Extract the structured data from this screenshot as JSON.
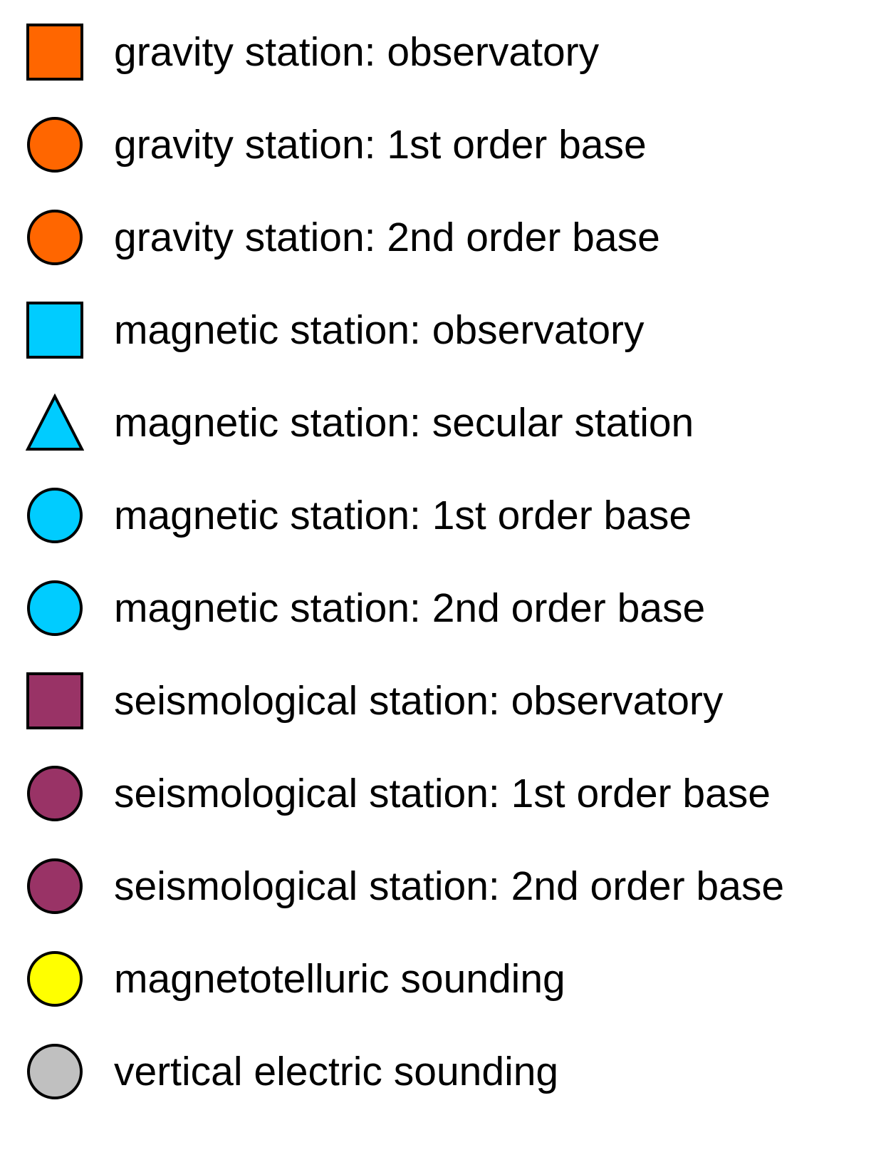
{
  "legend": {
    "items": [
      {
        "label": "gravity station: observatory",
        "shape": "square",
        "color": "#FF6600",
        "icon": "orange-square-icon"
      },
      {
        "label": "gravity station: 1st order base",
        "shape": "circle",
        "color": "#FF6600",
        "icon": "orange-circle-icon"
      },
      {
        "label": "gravity station: 2nd order base",
        "shape": "circle",
        "color": "#FF6600",
        "icon": "orange-circle-icon"
      },
      {
        "label": "magnetic station: observatory",
        "shape": "square",
        "color": "#00CCFF",
        "icon": "cyan-square-icon"
      },
      {
        "label": "magnetic station: secular station",
        "shape": "triangle",
        "color": "#00CCFF",
        "icon": "cyan-triangle-icon"
      },
      {
        "label": "magnetic station: 1st order base",
        "shape": "circle",
        "color": "#00CCFF",
        "icon": "cyan-circle-icon"
      },
      {
        "label": "magnetic station: 2nd order base",
        "shape": "circle",
        "color": "#00CCFF",
        "icon": "cyan-circle-icon"
      },
      {
        "label": "seismological station: observatory",
        "shape": "square",
        "color": "#993366",
        "icon": "purple-square-icon"
      },
      {
        "label": "seismological station: 1st order base",
        "shape": "circle",
        "color": "#993366",
        "icon": "purple-circle-icon"
      },
      {
        "label": "seismological station: 2nd order base",
        "shape": "circle",
        "color": "#993366",
        "icon": "purple-circle-icon"
      },
      {
        "label": "magnetotelluric sounding",
        "shape": "circle",
        "color": "#FFFF00",
        "icon": "yellow-circle-icon"
      },
      {
        "label": "vertical electric sounding",
        "shape": "circle",
        "color": "#C0C0C0",
        "icon": "gray-circle-icon"
      }
    ]
  }
}
